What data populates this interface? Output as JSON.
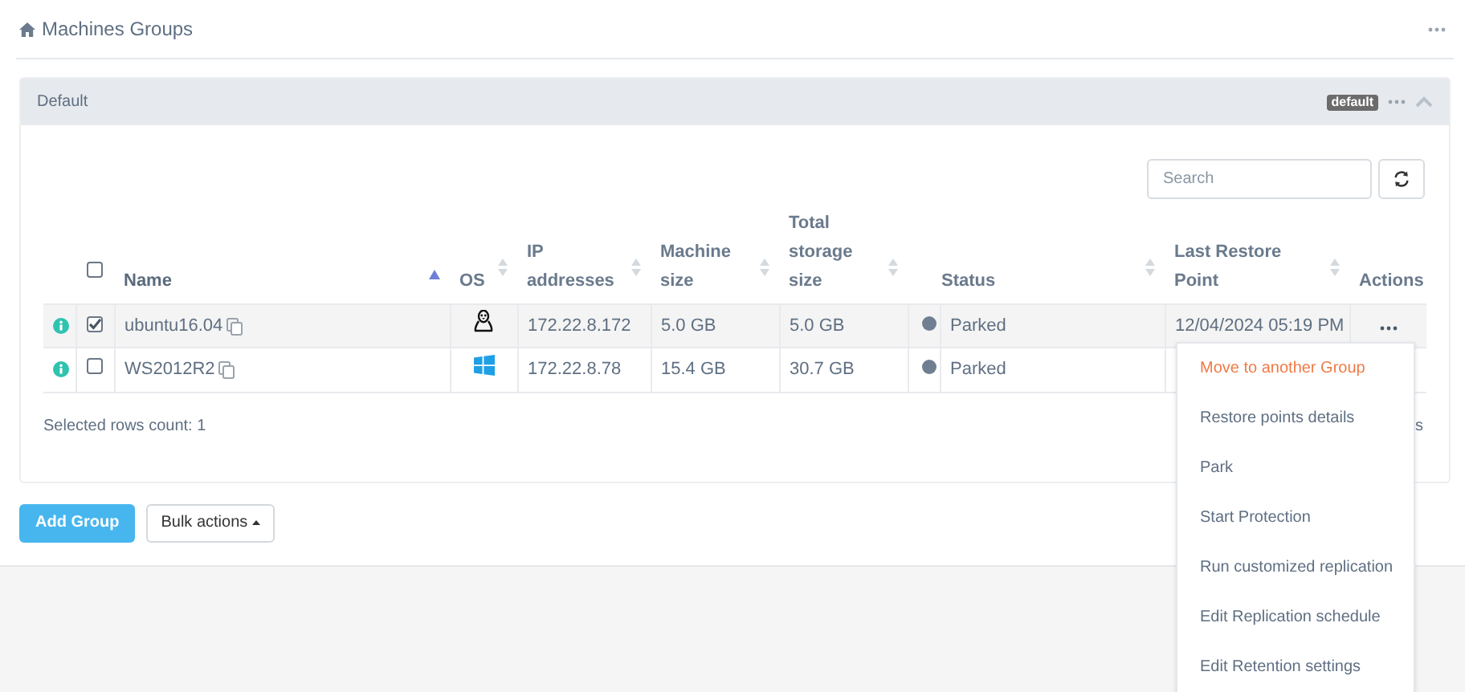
{
  "page": {
    "title": "Machines Groups"
  },
  "group": {
    "name": "Default",
    "badge": "default",
    "expanded": true
  },
  "search": {
    "placeholder": "Search"
  },
  "table": {
    "header_checked": false,
    "columns": [
      {
        "label": "Name",
        "sortable": true,
        "sorted": true
      },
      {
        "label": "OS",
        "sortable": true,
        "sorted": false
      },
      {
        "label": "IP addresses",
        "sortable": true,
        "sorted": false
      },
      {
        "label": "Machine size",
        "sortable": true,
        "sorted": false
      },
      {
        "label": "Total storage size",
        "sortable": true,
        "sorted": false
      },
      {
        "label": "Status",
        "sortable": true,
        "sorted": false
      },
      {
        "label": "Last Restore Point",
        "sortable": true,
        "sorted": false
      },
      {
        "label": "Actions",
        "sortable": false,
        "sorted": false
      }
    ],
    "rows": [
      {
        "name": "ubuntu16.04",
        "os": {
          "kind": "linux"
        },
        "ip": "172.22.8.172",
        "machine_size": "5.0 GB",
        "total_storage": "5.0 GB",
        "status": "Parked",
        "last_restore": "12/04/2024 05:19 PM",
        "checked": true,
        "menu_open": true
      },
      {
        "name": "WS2012R2",
        "os": {
          "kind": "windows"
        },
        "ip": "172.22.8.78",
        "machine_size": "15.4 GB",
        "total_storage": "30.7 GB",
        "status": "Parked",
        "checked": false,
        "menu_open": false
      }
    ]
  },
  "selected_count": "Selected rows count: 1",
  "footer_right": "s",
  "actions_menu": [
    {
      "label": "Move to another Group",
      "highlighted": true
    },
    {
      "label": "Restore points details",
      "highlighted": false
    },
    {
      "label": "Park",
      "highlighted": false
    },
    {
      "label": "Start Protection",
      "highlighted": false
    },
    {
      "label": "Run customized replication",
      "highlighted": false
    },
    {
      "label": "Edit Replication schedule",
      "highlighted": false
    },
    {
      "label": "Edit Retention settings",
      "highlighted": false
    }
  ],
  "buttons": {
    "add_group": "Add Group",
    "bulk_actions": "Bulk actions"
  }
}
